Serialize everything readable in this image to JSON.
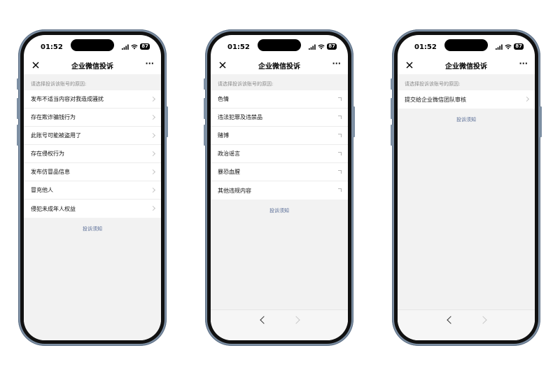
{
  "phones": [
    {
      "status": {
        "time": "01:52",
        "battery": "87"
      },
      "nav": {
        "title": "企业微信投诉",
        "close_icon": "close-icon",
        "more": "···"
      },
      "hint": "请选择投诉该账号的原因:",
      "items": [
        {
          "label": "发布不适当内容对我造成骚扰"
        },
        {
          "label": "存在欺诈骗钱行为"
        },
        {
          "label": "此账号可能被盗用了"
        },
        {
          "label": "存在侵权行为"
        },
        {
          "label": "发布仿冒品信息"
        },
        {
          "label": "冒充他人"
        },
        {
          "label": "侵犯未成年人权益"
        }
      ],
      "link": "投诉须知"
    },
    {
      "status": {
        "time": "01:52",
        "battery": "87"
      },
      "nav": {
        "title": "企业微信投诉",
        "close_icon": "close-icon",
        "more": "···"
      },
      "hint": "请选择投诉该账号的原因:",
      "items": [
        {
          "label": "色情"
        },
        {
          "label": "违法犯罪及违禁品"
        },
        {
          "label": "赌博"
        },
        {
          "label": "政治谣言"
        },
        {
          "label": "暴恐血腥"
        },
        {
          "label": "其他违规内容"
        }
      ],
      "link": "投诉须知"
    },
    {
      "status": {
        "time": "01:52",
        "battery": "87"
      },
      "nav": {
        "title": "企业微信投诉",
        "close_icon": "close-icon",
        "more": "···"
      },
      "hint": "请选择投诉该账号的原因:",
      "items": [
        {
          "label": "提交给企业微信团队审核"
        }
      ],
      "link": "投诉须知"
    }
  ],
  "colors": {
    "frame": "#7d8fa3",
    "link": "#576b95",
    "background": "#f2f2f2"
  }
}
